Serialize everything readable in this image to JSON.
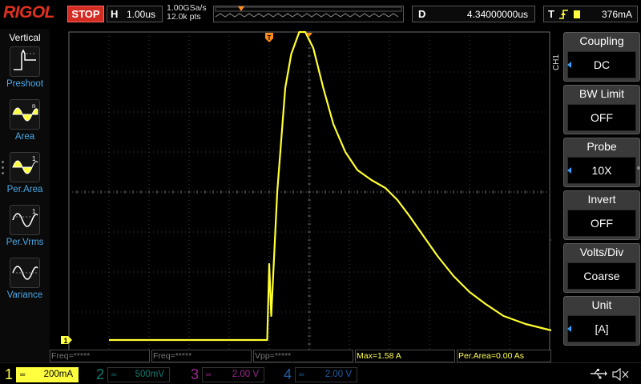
{
  "brand": {
    "logo": "RIGOL"
  },
  "status": {
    "run_state": "STOP"
  },
  "horizontal": {
    "label": "H",
    "timebase": "1.00us",
    "sample_rate": "1.00GSa/s",
    "points": "12.0k pts"
  },
  "delay": {
    "label": "D",
    "value": "4.34000000us"
  },
  "trigger": {
    "label": "T",
    "level": "376mA"
  },
  "left_menu": {
    "title": "Vertical",
    "items": [
      {
        "label": "Preshoot",
        "icon": "preshoot-icon"
      },
      {
        "label": "Area",
        "icon": "area-icon"
      },
      {
        "label": "Per.Area",
        "icon": "period-area-icon"
      },
      {
        "label": "Per.Vrms",
        "icon": "period-vrms-icon"
      },
      {
        "label": "Variance",
        "icon": "variance-icon"
      }
    ]
  },
  "right_menu": {
    "channel_tag": "CH1",
    "items": [
      {
        "label": "Coupling",
        "value": "DC"
      },
      {
        "label": "BW Limit",
        "value": "OFF"
      },
      {
        "label": "Probe",
        "value": "10X"
      },
      {
        "label": "Invert",
        "value": "OFF"
      },
      {
        "label": "Volts/Div",
        "value": "Coarse"
      },
      {
        "label": "Unit",
        "value": "[A]"
      }
    ]
  },
  "measurements": [
    {
      "text": "Freq=*****",
      "active": false
    },
    {
      "text": "Freq=*****",
      "active": false
    },
    {
      "text": "Vpp=*****",
      "active": false
    },
    {
      "text": "Max=1.58 A",
      "active": true
    },
    {
      "text": "Per.Area=0.00 As",
      "active": true
    }
  ],
  "channels": [
    {
      "num": "1",
      "scale": "200mA",
      "color": "#ffff40",
      "active": true
    },
    {
      "num": "2",
      "scale": "500mV",
      "color": "#0e7b71",
      "active": false
    },
    {
      "num": "3",
      "scale": "2.00 V",
      "color": "#9a2a8e",
      "active": false
    },
    {
      "num": "4",
      "scale": "2.00 V",
      "color": "#1d5fa8",
      "active": false
    }
  ],
  "colors": {
    "trace": "#ffff30",
    "marker": "#ff8a1c",
    "grid": "#3c3c3c"
  },
  "waveform": {
    "units_x": "div",
    "units_y": "div",
    "baseline_div": -3.7,
    "points": [
      [
        -5.0,
        -3.7
      ],
      [
        -1.2,
        -3.7
      ],
      [
        -1.05,
        -3.7
      ],
      [
        -1.0,
        -1.8
      ],
      [
        -0.95,
        -3.1
      ],
      [
        -0.8,
        0.0
      ],
      [
        -0.6,
        2.6
      ],
      [
        -0.45,
        3.45
      ],
      [
        -0.25,
        4.0
      ],
      [
        -0.1,
        4.0
      ],
      [
        0.1,
        3.6
      ],
      [
        0.35,
        2.6
      ],
      [
        0.6,
        1.7
      ],
      [
        0.9,
        1.0
      ],
      [
        1.2,
        0.55
      ],
      [
        1.55,
        0.3
      ],
      [
        1.9,
        0.1
      ],
      [
        2.2,
        -0.2
      ],
      [
        2.5,
        -0.6
      ],
      [
        2.85,
        -1.1
      ],
      [
        3.2,
        -1.6
      ],
      [
        3.6,
        -2.1
      ],
      [
        4.0,
        -2.5
      ],
      [
        4.4,
        -2.8
      ],
      [
        4.85,
        -3.1
      ],
      [
        5.4,
        -3.3
      ],
      [
        6.0,
        -3.45
      ],
      [
        6.6,
        -3.53
      ],
      [
        7.0,
        -3.57
      ]
    ]
  }
}
